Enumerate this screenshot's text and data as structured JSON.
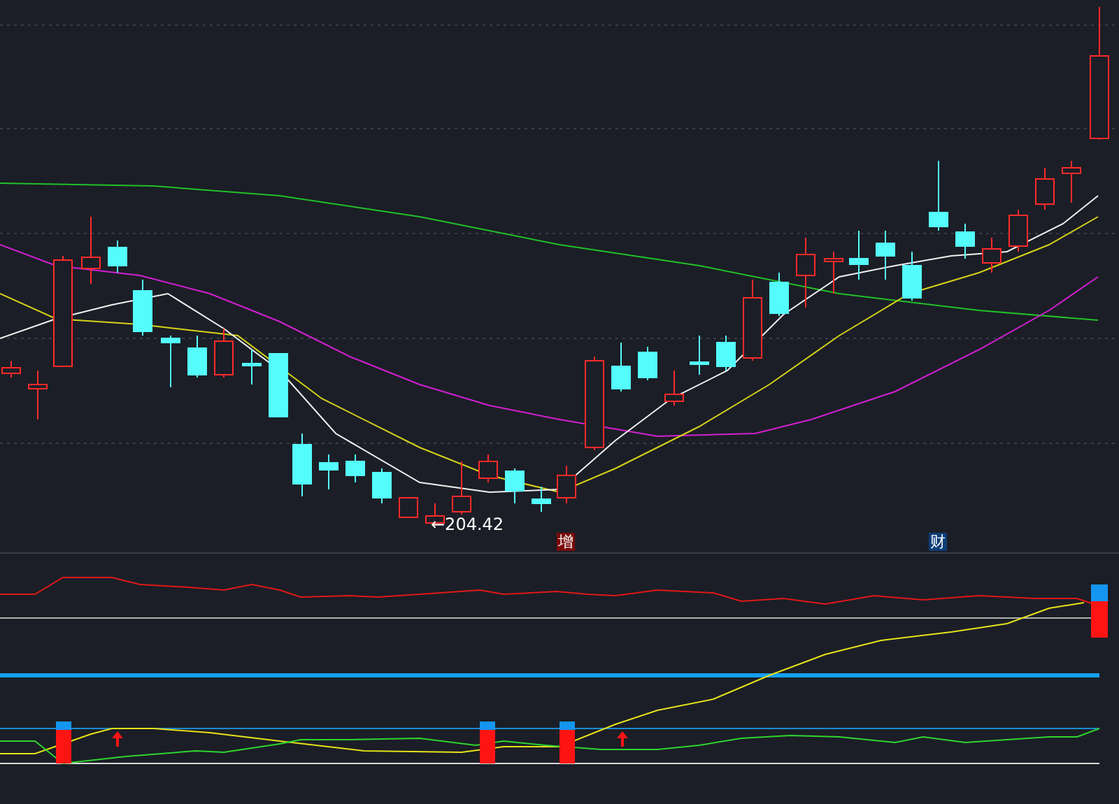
{
  "main_chart": {
    "low_label": "←204.42",
    "markers": [
      {
        "text": "增",
        "kind": "increase"
      },
      {
        "text": "财",
        "kind": "finance"
      }
    ]
  }
}
